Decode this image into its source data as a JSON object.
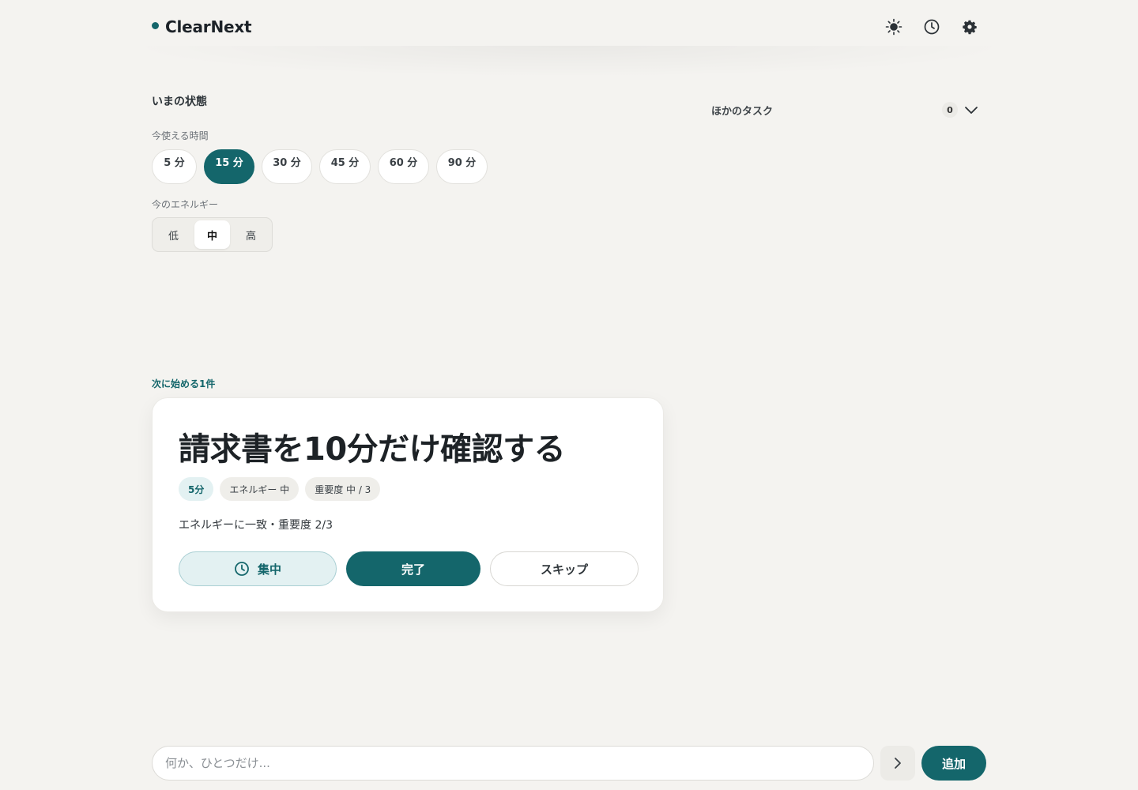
{
  "app": {
    "name": "ClearNext",
    "accent": "#14666b"
  },
  "header": {
    "icons": [
      "sun-icon",
      "clock-icon",
      "gear-icon"
    ]
  },
  "state": {
    "title": "いまの状態",
    "time_label": "今使える時間",
    "time_options": [
      "5 分",
      "15 分",
      "30 分",
      "45 分",
      "60 分",
      "90 分"
    ],
    "time_selected": "15 分",
    "energy_label": "今のエネルギー",
    "energy_options": [
      "低",
      "中",
      "高"
    ],
    "energy_selected": "中"
  },
  "other_tasks": {
    "label": "ほかのタスク",
    "count": "0"
  },
  "next": {
    "label": "次に始める1件",
    "title": "請求書を10分だけ確認する",
    "chips": [
      "5分",
      "エネルギー 中",
      "重要度 中 / 3"
    ],
    "reason": "エネルギーに一致・重要度 2/3",
    "focus_label": "集中",
    "done_label": "完了",
    "skip_label": "スキップ"
  },
  "composer": {
    "placeholder": "何か、ひとつだけ...",
    "value": "",
    "add_label": "追加"
  }
}
